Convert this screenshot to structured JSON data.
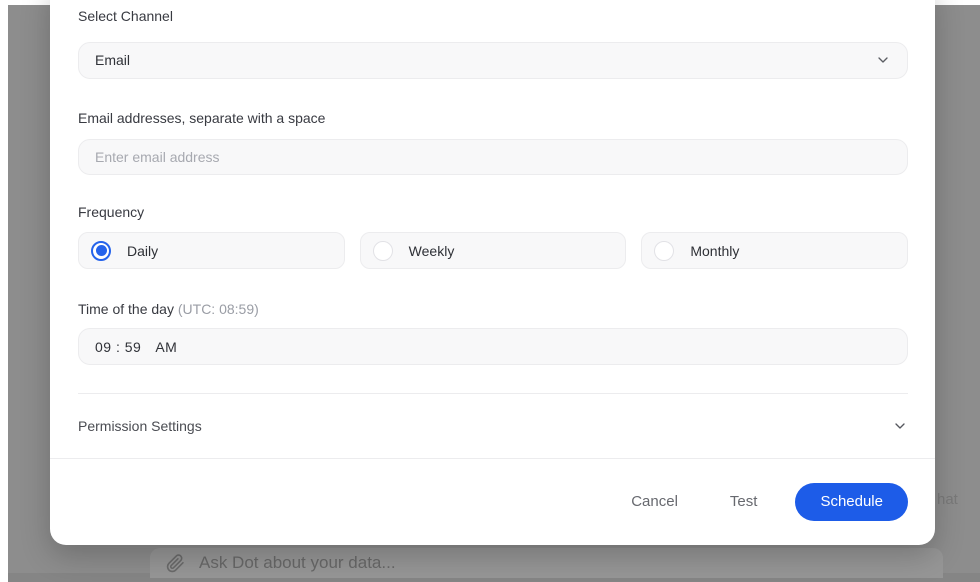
{
  "modal": {
    "channel": {
      "label": "Select Channel",
      "value": "Email"
    },
    "email": {
      "label": "Email addresses, separate with a space",
      "placeholder": "Enter email address"
    },
    "frequency": {
      "label": "Frequency",
      "options": [
        {
          "label": "Daily",
          "selected": true
        },
        {
          "label": "Weekly",
          "selected": false
        },
        {
          "label": "Monthly",
          "selected": false
        }
      ]
    },
    "time": {
      "label": "Time of the day",
      "sublabel": "(UTC: 08:59)",
      "value": "09 : 59",
      "meridiem": "AM"
    },
    "permission": {
      "label": "Permission Settings"
    },
    "footer": {
      "cancel": "Cancel",
      "test": "Test",
      "schedule": "Schedule"
    }
  },
  "background": {
    "chat_placeholder": "Ask Dot about your data...",
    "partial_text": "hat"
  },
  "colors": {
    "accent_blue": "#2563eb",
    "button_blue": "#1d5ce8",
    "dim_gray": "#8d8d8d"
  }
}
